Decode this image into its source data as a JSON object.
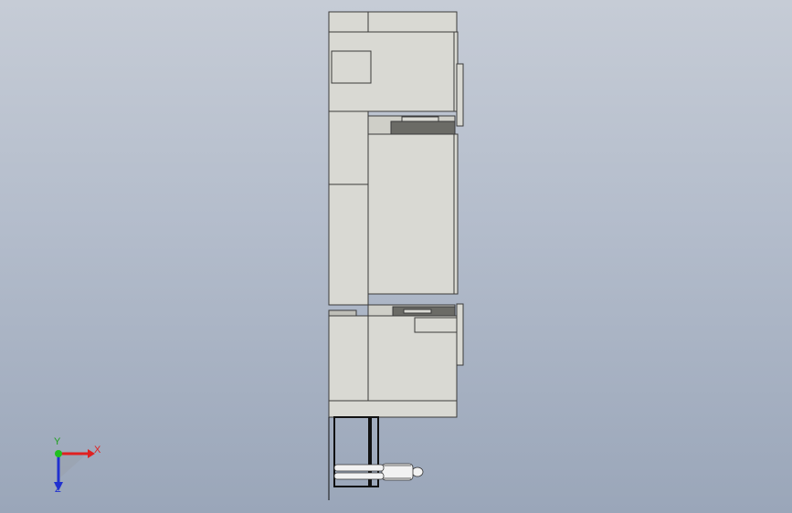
{
  "viewport": {
    "background_top": "#c6ccd6",
    "background_bottom": "#9aa6b9"
  },
  "model": {
    "body_fill": "#d9d9d3",
    "edge_color": "#3a3a3a",
    "dark_fill": "#6b6b66"
  },
  "triad": {
    "x_label": "X",
    "y_label": "Y",
    "z_label": "Z",
    "x_color": "#e02020",
    "y_color": "#20c020",
    "z_color": "#2030d0"
  }
}
